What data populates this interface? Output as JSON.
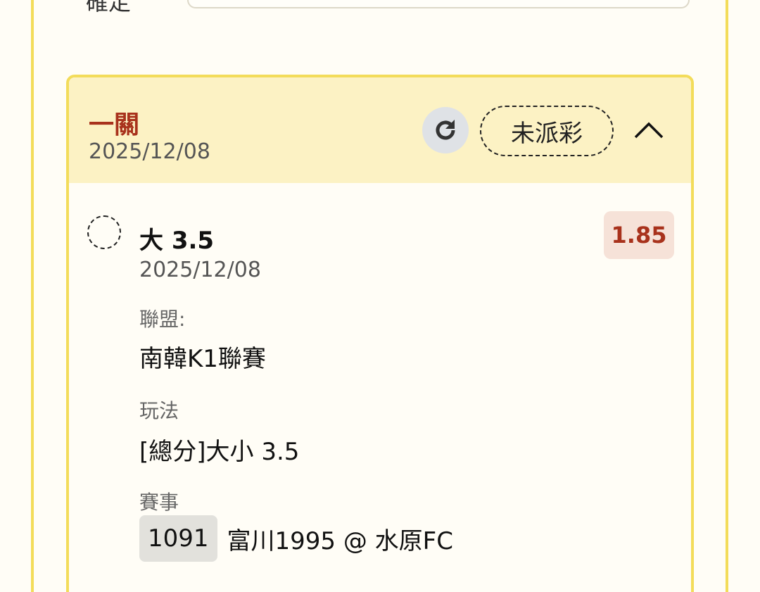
{
  "top_row": {
    "label": "確定"
  },
  "bet": {
    "type": "一關",
    "date": "2025/12/08",
    "status": "未派彩",
    "icons": {
      "refresh": "refresh-icon",
      "collapse": "chevron-up-icon",
      "pending": "pending-circle-icon"
    },
    "selection": {
      "name": "大 3.5",
      "date": "2025/12/08",
      "odds": "1.85",
      "league_label": "聯盟:",
      "league": "南韓K1聯賽",
      "play_label": "玩法",
      "play": "[總分]大小 3.5",
      "match_label": "賽事",
      "match_no": "1091",
      "match": "富川1995 @ 水原FC"
    }
  },
  "colors": {
    "accent": "#a8321c",
    "border": "#f3dc5a",
    "header_bg": "#fcf2c4",
    "odds_bg": "#f6e2d8"
  }
}
